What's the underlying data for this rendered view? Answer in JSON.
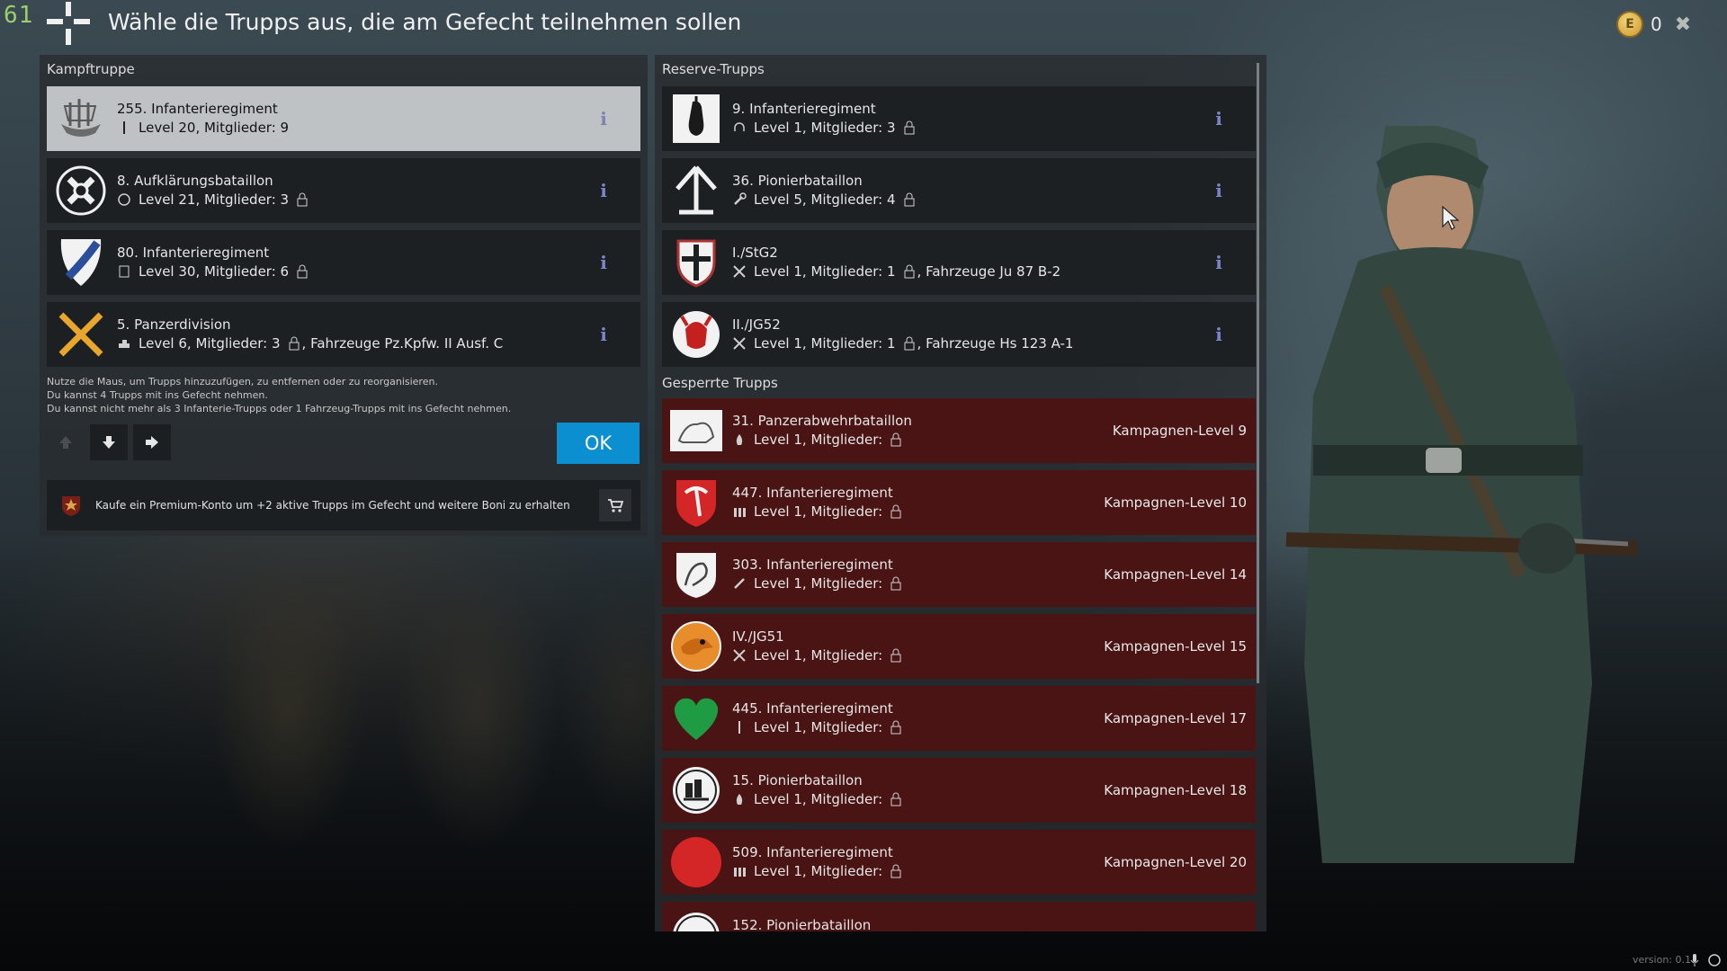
{
  "header": {
    "fps_counter": "61",
    "title": "Wähle die Trupps aus, die am Gefecht teilnehmen sollen",
    "currency_symbol": "E",
    "currency_value": "0",
    "close_symbol": "✖"
  },
  "left_panel": {
    "title": "Kampftruppe",
    "units": [
      {
        "name": "255. Infanterieregiment",
        "stats": "Level 20, Mitglieder: 9",
        "emblem": "ship-emblem-icon",
        "class_icon": "rifle-icon"
      },
      {
        "name": "8. Aufklärungsbataillon",
        "stats": "Level 21, Mitglieder: 3",
        "emblem": "recon-cross-emblem-icon",
        "class_icon": "scope-icon"
      },
      {
        "name": "80. Infanterieregiment",
        "stats": "Level 30, Mitglieder: 6",
        "emblem": "shield-emblem-icon",
        "class_icon": "radio-icon"
      },
      {
        "name": "5. Panzerdivision",
        "stats": "Level 6, Mitglieder: 3",
        "vehicle": ", Fahrzeuge Pz.Kpfw. II Ausf. C",
        "emblem": "crossed-x-emblem-icon",
        "class_icon": "tank-icon"
      }
    ],
    "info_glyph": "i",
    "help_lines": [
      "Nutze die Maus, um Trupps hinzuzufügen, zu entfernen oder zu reorganisieren.",
      "Du kannst 4 Trupps mit ins Gefecht nehmen.",
      "Du kannst nicht mehr als 3 Infanterie-Trupps oder 1 Fahrzeug-Trupps mit ins Gefecht nehmen."
    ],
    "ok_label": "OK",
    "premium_text": "Kaufe ein Premium-Konto um +2 aktive Trupps im Gefecht und weitere Boni zu erhalten"
  },
  "right_panel": {
    "reserve_title": "Reserve-Trupps",
    "reserve_units": [
      {
        "name": "9. Infanterieregiment",
        "stats": "Level 1, Mitglieder: 3",
        "emblem": "hand-grenade-emblem-icon",
        "class_icon": "headphones-icon"
      },
      {
        "name": "36. Pionierbataillon",
        "stats": "Level 5, Mitglieder: 4",
        "emblem": "arrow-up-emblem-icon",
        "class_icon": "wrench-icon"
      },
      {
        "name": "I./StG2",
        "stats": "Level 1, Mitglieder: 1",
        "vehicle": ", Fahrzeuge Ju 87 B-2",
        "emblem": "shield-cross-emblem-icon",
        "class_icon": "crossed-swords-icon"
      },
      {
        "name": "II./JG52",
        "stats": "Level 1, Mitglieder: 1",
        "vehicle": ", Fahrzeuge Hs 123 A-1",
        "emblem": "red-devil-emblem-icon",
        "class_icon": "crossed-swords-icon"
      }
    ],
    "locked_title": "Gesperrte Trupps",
    "locked_units": [
      {
        "name": "31. Panzerabwehrbataillon",
        "stats": "Level 1, Mitglieder:",
        "requirement": "Kampagnen-Level 9",
        "emblem": "lion-emblem-icon",
        "class_icon": "flame-icon"
      },
      {
        "name": "447. Infanterieregiment",
        "stats": "Level 1, Mitglieder:",
        "requirement": "Kampagnen-Level 10",
        "emblem": "red-pickaxe-emblem-icon",
        "class_icon": "ammo-icon"
      },
      {
        "name": "303. Infanterieregiment",
        "stats": "Level 1, Mitglieder:",
        "requirement": "Kampagnen-Level 14",
        "emblem": "griffin-emblem-icon",
        "class_icon": "knife-icon"
      },
      {
        "name": "IV./JG51",
        "stats": "Level 1, Mitglieder:",
        "requirement": "Kampagnen-Level 15",
        "emblem": "eagle-emblem-icon",
        "class_icon": "crossed-swords-icon"
      },
      {
        "name": "445. Infanterieregiment",
        "stats": "Level 1, Mitglieder:",
        "requirement": "Kampagnen-Level 17",
        "emblem": "green-heart-emblem-icon",
        "class_icon": "rifle-icon"
      },
      {
        "name": "15. Pionierbataillon",
        "stats": "Level 1, Mitglieder:",
        "requirement": "Kampagnen-Level 18",
        "emblem": "engineer-emblem-icon",
        "class_icon": "flame-icon"
      },
      {
        "name": "509. Infanterieregiment",
        "stats": "Level 1, Mitglieder:",
        "requirement": "Kampagnen-Level 20",
        "emblem": "red-circle-emblem-icon",
        "class_icon": "ammo-icon"
      },
      {
        "name": "152. Pionierbataillon",
        "stats": "",
        "requirement": "",
        "emblem": "engineer-emblem-icon",
        "class_icon": ""
      }
    ]
  },
  "footer": {
    "version": "version: 0.1"
  },
  "colors": {
    "accent_blue": "#0c8fd1",
    "locked_red": "#4a1414",
    "selected_gray": "#bfc2c4",
    "info_purple": "#7d86c8"
  }
}
